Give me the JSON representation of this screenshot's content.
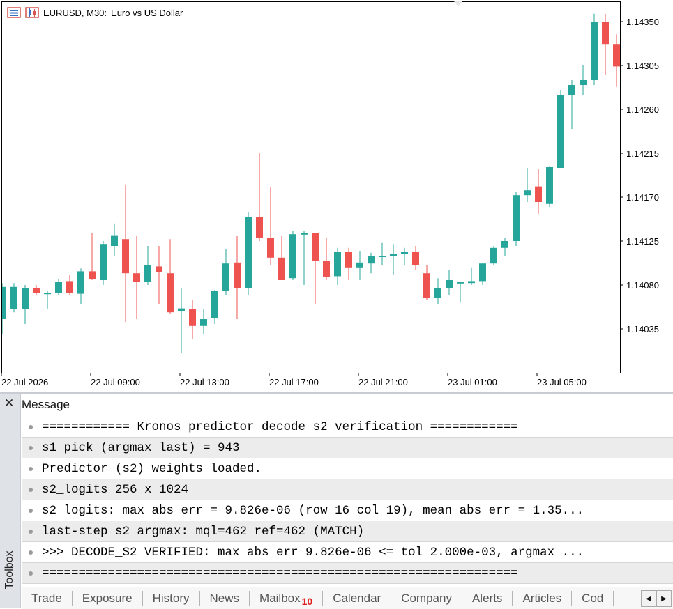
{
  "chart": {
    "symbol": "EURUSD, M30:",
    "description": "Euro vs US Dollar",
    "colors": {
      "bull": "#26a69a",
      "bear": "#ef5350",
      "frame": "#000000"
    }
  },
  "chart_data": {
    "type": "candlestick",
    "title": "EURUSD, M30:  Euro vs US Dollar",
    "ylim": [
      1.13985,
      1.1437
    ],
    "y_ticks": [
      "1.14350",
      "1.14305",
      "1.14260",
      "1.14215",
      "1.14170",
      "1.14125",
      "1.14080",
      "1.14035"
    ],
    "y_tick_values": [
      1.1435,
      1.14305,
      1.1426,
      1.14215,
      1.1417,
      1.14125,
      1.1408,
      1.14035
    ],
    "x_ticks": [
      "22 Jul 2026",
      "22 Jul 09:00",
      "22 Jul 13:00",
      "22 Jul 17:00",
      "22 Jul 21:00",
      "23 Jul 01:00",
      "23 Jul 05:00"
    ],
    "x_tick_bar_index": [
      0,
      8,
      16,
      24,
      32,
      40,
      48
    ],
    "bars": [
      {
        "o": 1.14045,
        "h": 1.14082,
        "l": 1.1403,
        "c": 1.14078
      },
      {
        "o": 1.14055,
        "h": 1.14082,
        "l": 1.14052,
        "c": 1.14078
      },
      {
        "o": 1.14055,
        "h": 1.1408,
        "l": 1.1404,
        "c": 1.14077
      },
      {
        "o": 1.14077,
        "h": 1.1408,
        "l": 1.1407,
        "c": 1.14072
      },
      {
        "o": 1.14072,
        "h": 1.14074,
        "l": 1.14055,
        "c": 1.14072
      },
      {
        "o": 1.14072,
        "h": 1.14086,
        "l": 1.1407,
        "c": 1.14083
      },
      {
        "o": 1.14084,
        "h": 1.1409,
        "l": 1.1407,
        "c": 1.14072
      },
      {
        "o": 1.14071,
        "h": 1.14097,
        "l": 1.1406,
        "c": 1.14094
      },
      {
        "o": 1.14094,
        "h": 1.14133,
        "l": 1.14085,
        "c": 1.14086
      },
      {
        "o": 1.14085,
        "h": 1.14125,
        "l": 1.1408,
        "c": 1.14122
      },
      {
        "o": 1.1412,
        "h": 1.14143,
        "l": 1.1411,
        "c": 1.14131
      },
      {
        "o": 1.14127,
        "h": 1.14183,
        "l": 1.14042,
        "c": 1.14092
      },
      {
        "o": 1.14092,
        "h": 1.1413,
        "l": 1.14045,
        "c": 1.14083
      },
      {
        "o": 1.14083,
        "h": 1.1412,
        "l": 1.1408,
        "c": 1.141
      },
      {
        "o": 1.14099,
        "h": 1.1412,
        "l": 1.1406,
        "c": 1.14093
      },
      {
        "o": 1.14092,
        "h": 1.14127,
        "l": 1.1405,
        "c": 1.14052
      },
      {
        "o": 1.14053,
        "h": 1.14077,
        "l": 1.1401,
        "c": 1.14056
      },
      {
        "o": 1.14055,
        "h": 1.14065,
        "l": 1.14025,
        "c": 1.14038
      },
      {
        "o": 1.14038,
        "h": 1.14055,
        "l": 1.1403,
        "c": 1.14045
      },
      {
        "o": 1.14046,
        "h": 1.14075,
        "l": 1.1404,
        "c": 1.14074
      },
      {
        "o": 1.14074,
        "h": 1.14117,
        "l": 1.1407,
        "c": 1.14102
      },
      {
        "o": 1.14103,
        "h": 1.1413,
        "l": 1.14045,
        "c": 1.14077
      },
      {
        "o": 1.14077,
        "h": 1.14155,
        "l": 1.1407,
        "c": 1.1415
      },
      {
        "o": 1.1415,
        "h": 1.14215,
        "l": 1.14125,
        "c": 1.14128
      },
      {
        "o": 1.14128,
        "h": 1.1418,
        "l": 1.141,
        "c": 1.14108
      },
      {
        "o": 1.14108,
        "h": 1.1413,
        "l": 1.1409,
        "c": 1.14085
      },
      {
        "o": 1.14087,
        "h": 1.14135,
        "l": 1.14085,
        "c": 1.14132
      },
      {
        "o": 1.14132,
        "h": 1.14135,
        "l": 1.1408,
        "c": 1.14133
      },
      {
        "o": 1.14133,
        "h": 1.14133,
        "l": 1.1406,
        "c": 1.14105
      },
      {
        "o": 1.14105,
        "h": 1.14128,
        "l": 1.14085,
        "c": 1.14088
      },
      {
        "o": 1.14089,
        "h": 1.14118,
        "l": 1.1408,
        "c": 1.14114
      },
      {
        "o": 1.14114,
        "h": 1.14118,
        "l": 1.14085,
        "c": 1.14098
      },
      {
        "o": 1.14098,
        "h": 1.14115,
        "l": 1.14085,
        "c": 1.14103
      },
      {
        "o": 1.14102,
        "h": 1.14113,
        "l": 1.14092,
        "c": 1.1411
      },
      {
        "o": 1.1411,
        "h": 1.14123,
        "l": 1.141,
        "c": 1.1411
      },
      {
        "o": 1.1411,
        "h": 1.14122,
        "l": 1.1409,
        "c": 1.14112
      },
      {
        "o": 1.14112,
        "h": 1.14118,
        "l": 1.141,
        "c": 1.14114
      },
      {
        "o": 1.14114,
        "h": 1.1412,
        "l": 1.14095,
        "c": 1.141
      },
      {
        "o": 1.14092,
        "h": 1.141,
        "l": 1.14065,
        "c": 1.14067
      },
      {
        "o": 1.14067,
        "h": 1.14087,
        "l": 1.1406,
        "c": 1.14077
      },
      {
        "o": 1.14077,
        "h": 1.14095,
        "l": 1.1407,
        "c": 1.14085
      },
      {
        "o": 1.14082,
        "h": 1.14083,
        "l": 1.14062,
        "c": 1.14083
      },
      {
        "o": 1.14082,
        "h": 1.14098,
        "l": 1.1408,
        "c": 1.14084
      },
      {
        "o": 1.14084,
        "h": 1.141,
        "l": 1.1408,
        "c": 1.14102
      },
      {
        "o": 1.14102,
        "h": 1.1412,
        "l": 1.141,
        "c": 1.14118
      },
      {
        "o": 1.14118,
        "h": 1.14128,
        "l": 1.1411,
        "c": 1.14125
      },
      {
        "o": 1.14125,
        "h": 1.14175,
        "l": 1.1412,
        "c": 1.14172
      },
      {
        "o": 1.14172,
        "h": 1.142,
        "l": 1.14165,
        "c": 1.14177
      },
      {
        "o": 1.14181,
        "h": 1.14199,
        "l": 1.14153,
        "c": 1.14165
      },
      {
        "o": 1.14163,
        "h": 1.14202,
        "l": 1.1416,
        "c": 1.14201
      },
      {
        "o": 1.142,
        "h": 1.1428,
        "l": 1.142,
        "c": 1.14275
      },
      {
        "o": 1.14275,
        "h": 1.1429,
        "l": 1.1424,
        "c": 1.14285
      },
      {
        "o": 1.14285,
        "h": 1.14305,
        "l": 1.14275,
        "c": 1.1429
      },
      {
        "o": 1.1429,
        "h": 1.14358,
        "l": 1.14285,
        "c": 1.1435
      },
      {
        "o": 1.1435,
        "h": 1.14358,
        "l": 1.14295,
        "c": 1.14327
      },
      {
        "o": 1.14327,
        "h": 1.14337,
        "l": 1.14283,
        "c": 1.14304
      },
      {
        "o": 1.14304,
        "h": 1.14315,
        "l": 1.14288,
        "c": 1.14299
      }
    ]
  },
  "toolbox": {
    "close_glyph": "✕",
    "label": "Toolbox",
    "column_header": "Message",
    "messages": [
      "============ Kronos predictor decode_s2 verification ============",
      "s1_pick (argmax last) = 943",
      "Predictor (s2) weights loaded.",
      "s2_logits 256 x 1024",
      "s2 logits: max abs err = 9.826e-06 (row 16 col 19), mean abs err = 1.35...",
      "last-step s2 argmax: mql=462 ref=462 (MATCH)",
      ">>> DECODE_S2 VERIFIED: max abs err 9.826e-06 <= tol 2.000e-03, argmax ...",
      "================================================================="
    ],
    "tabs": [
      "Trade",
      "Exposure",
      "History",
      "News",
      "Mailbox",
      "Calendar",
      "Company",
      "Alerts",
      "Articles",
      "Cod"
    ],
    "mailbox_badge": "10",
    "scroll_left": "◀",
    "scroll_right": "▶"
  }
}
